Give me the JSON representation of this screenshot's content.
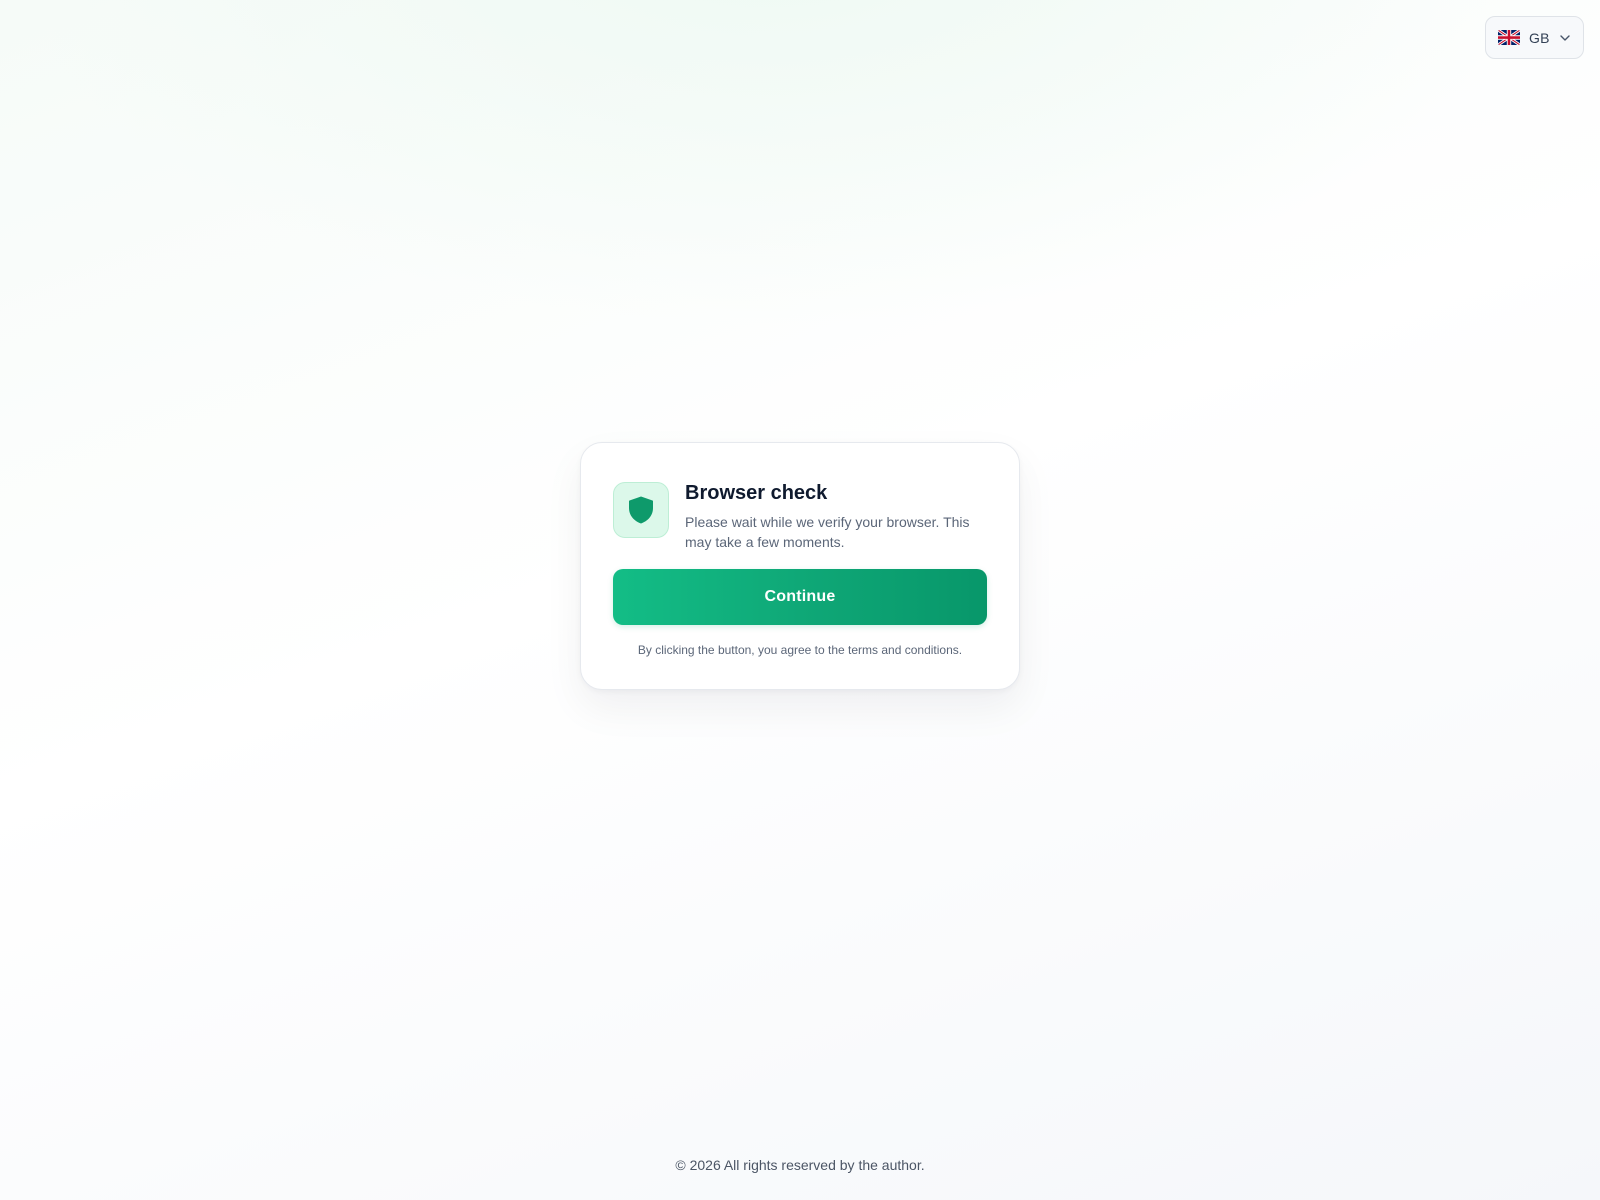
{
  "language": {
    "code": "GB",
    "flag_icon": "uk-flag-icon",
    "chevron_icon": "chevron-down-icon"
  },
  "card": {
    "icon": "shield-icon",
    "title": "Browser check",
    "description": "Please wait while we verify your browser. This may take a few moments.",
    "button_label": "Continue",
    "terms": "By clicking the button, you agree to the terms and conditions."
  },
  "footer": {
    "copyright": "© 2026 All rights reserved by the author."
  },
  "colors": {
    "accent": "#10b37e",
    "accent_dark": "#08976a",
    "icon_bg": "#dcf8ea",
    "shield": "#0e9a6b"
  }
}
